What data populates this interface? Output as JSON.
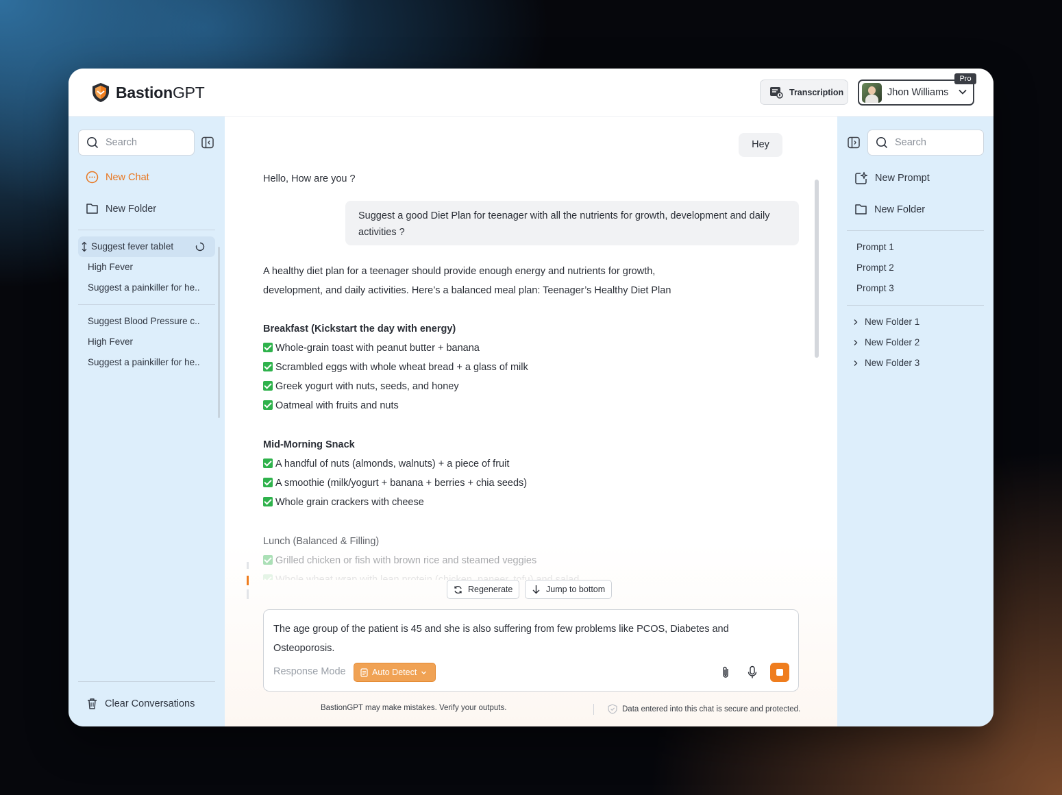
{
  "app": {
    "name_bold": "Bastion",
    "name_rest": "GPT"
  },
  "header": {
    "transcription_label": "Transcription",
    "user_name": "Jhon Williams",
    "plan_badge": "Pro"
  },
  "left_sidebar": {
    "search_placeholder": "Search",
    "new_chat_label": "New Chat",
    "new_folder_label": "New Folder",
    "history_group_1": [
      "Suggest fever tablet",
      "High Fever",
      "Suggest a painkiller for he.."
    ],
    "history_group_2": [
      "Suggest Blood Pressure c..",
      "High Fever",
      "Suggest a painkiller for he.."
    ],
    "clear_label": "Clear Conversations"
  },
  "chat": {
    "user_msg_1": "Hey",
    "assistant_msg_1": "Hello, How are you ?",
    "user_msg_2": "Suggest a good Diet Plan for teenager with all the nutrients for growth, development and daily activities ?",
    "intro_line_1": "A healthy diet plan for a teenager should provide enough energy and nutrients for growth,",
    "intro_line_2": "development, and daily activities. Here’s a balanced meal plan: Teenager’s Healthy Diet Plan",
    "breakfast_heading": "Breakfast (Kickstart the day with energy)",
    "breakfast_items": [
      "Whole-grain toast with peanut butter + banana",
      "Scrambled eggs with whole wheat bread + a glass of milk",
      "Greek yogurt with nuts, seeds, and honey",
      "Oatmeal with fruits and nuts"
    ],
    "snack_heading": "Mid-Morning Snack",
    "snack_items": [
      "A handful of nuts (almonds, walnuts) + a piece of fruit",
      "A smoothie (milk/yogurt + banana + berries + chia seeds)",
      "Whole grain crackers with cheese"
    ],
    "lunch_heading": "Lunch (Balanced & Filling)",
    "lunch_items": [
      "Grilled chicken or fish with brown rice and steamed veggies",
      "Whole wheat wrap with lean protein (chicken, paneer, tofu) and salad"
    ]
  },
  "actions": {
    "regenerate_label": "Regenerate",
    "jump_label": "Jump to bottom"
  },
  "composer": {
    "input_text": "The age group of the patient is 45 and she is also suffering from few problems like PCOS, Diabetes and Osteoporosis.",
    "response_mode_label": "Response Mode",
    "auto_detect_label": "Auto Detect"
  },
  "footer": {
    "disclaimer": "BastionGPT may make mistakes. Verify your outputs.",
    "security_note": "Data entered into this chat is secure and protected."
  },
  "right_sidebar": {
    "search_placeholder": "Search",
    "new_prompt_label": "New Prompt",
    "new_folder_label": "New Folder",
    "prompts": [
      "Prompt 1",
      "Prompt 2",
      "Prompt 3"
    ],
    "folders": [
      "New Folder 1",
      "New Folder 2",
      "New Folder 3"
    ]
  },
  "colors": {
    "accent": "#ef7d1e",
    "sidebar_bg": "#ddeefb",
    "check_green": "#2fb24c"
  }
}
